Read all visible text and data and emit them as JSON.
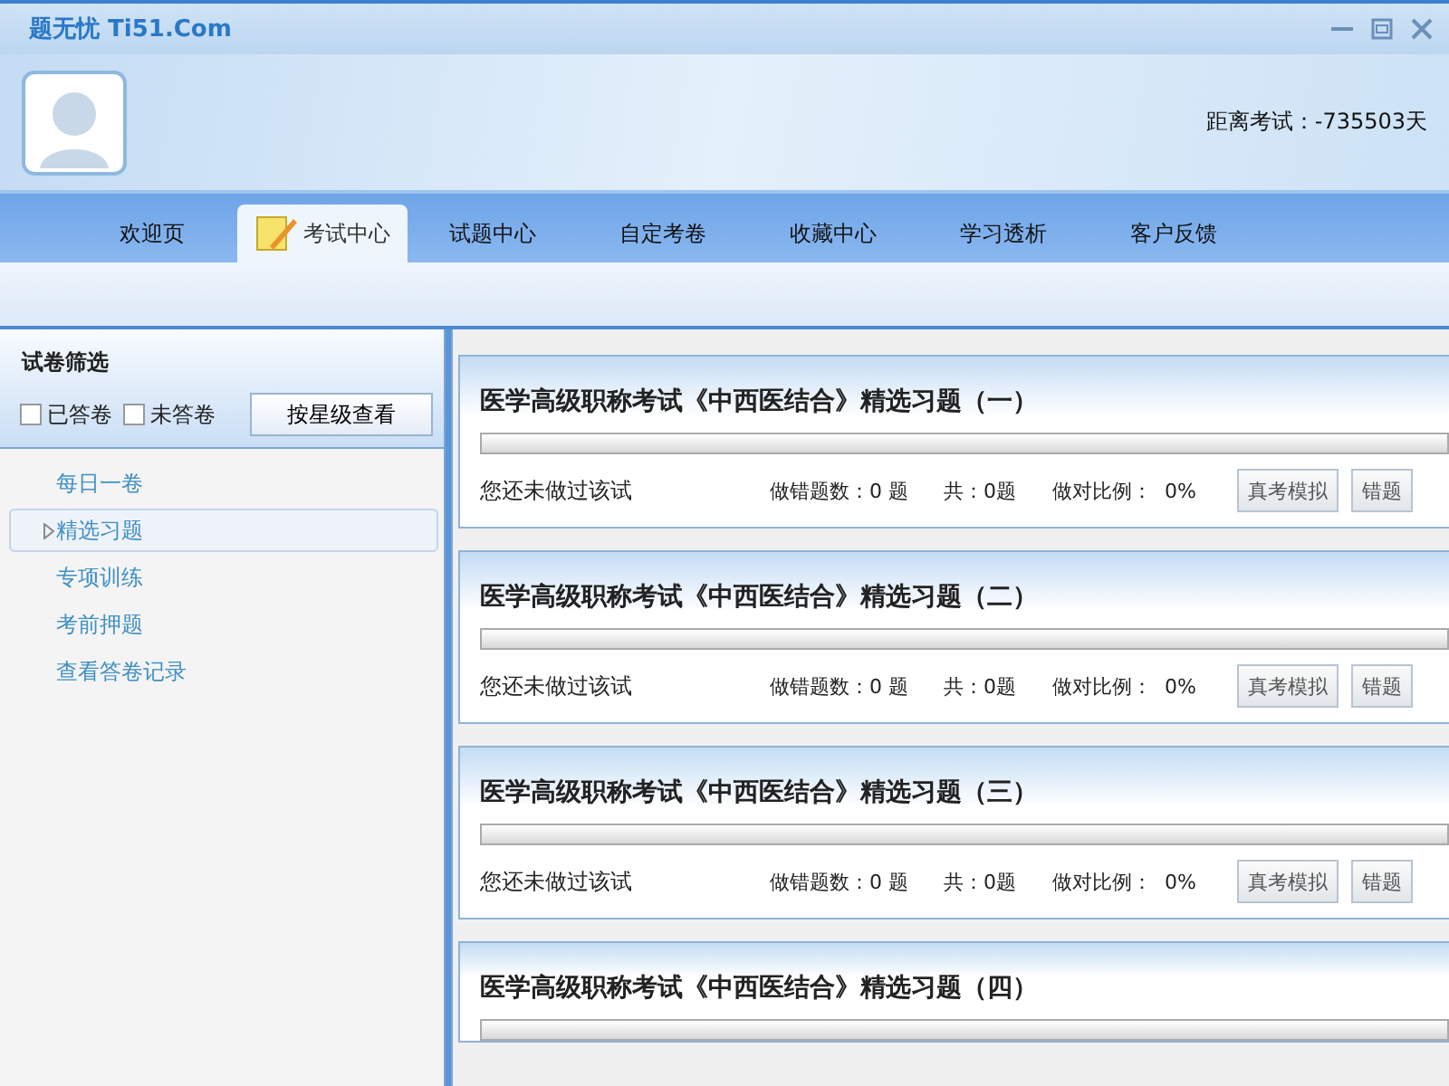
{
  "window": {
    "title": "题无忧 Ti51.Com"
  },
  "header": {
    "countdown": "距离考试：-735503天"
  },
  "tabs": [
    {
      "label": "欢迎页",
      "selected": false
    },
    {
      "label": "考试中心",
      "selected": true
    },
    {
      "label": "试题中心",
      "selected": false
    },
    {
      "label": "自定考卷",
      "selected": false
    },
    {
      "label": "收藏中心",
      "selected": false
    },
    {
      "label": "学习透析",
      "selected": false
    },
    {
      "label": "客户反馈",
      "selected": false
    }
  ],
  "sidebar": {
    "title": "试卷筛选",
    "filters": [
      {
        "label": "已答卷",
        "checked": false
      },
      {
        "label": "未答卷",
        "checked": false
      }
    ],
    "star_button": "按星级查看",
    "items": [
      {
        "label": "每日一卷",
        "selected": false
      },
      {
        "label": "精选习题",
        "selected": true
      },
      {
        "label": "专项训练",
        "selected": false
      },
      {
        "label": "考前押题",
        "selected": false
      },
      {
        "label": "查看答卷记录",
        "selected": false
      }
    ]
  },
  "papers": [
    {
      "title": "医学高级职称考试《中西医结合》精选习题（一）",
      "level": 0,
      "status": "您还未做过该试",
      "wrong": "做错题数：0 题",
      "total": "共：0题",
      "ratio_label": "做对比例：",
      "ratio": "0%",
      "buttons": [
        "真考模拟",
        "错题"
      ]
    },
    {
      "title": "医学高级职称考试《中西医结合》精选习题（二）",
      "level": 0,
      "status": "您还未做过该试",
      "wrong": "做错题数：0 题",
      "total": "共：0题",
      "ratio_label": "做对比例：",
      "ratio": "0%",
      "buttons": [
        "真考模拟",
        "错题"
      ]
    },
    {
      "title": "医学高级职称考试《中西医结合》精选习题（三）",
      "level": 0,
      "status": "您还未做过该试",
      "wrong": "做错题数：0 题",
      "total": "共：0题",
      "ratio_label": "做对比例：",
      "ratio": "0%",
      "buttons": [
        "真考模拟",
        "错题"
      ]
    },
    {
      "title": "医学高级职称考试《中西医结合》精选习题（四）",
      "level": 0
    }
  ]
}
